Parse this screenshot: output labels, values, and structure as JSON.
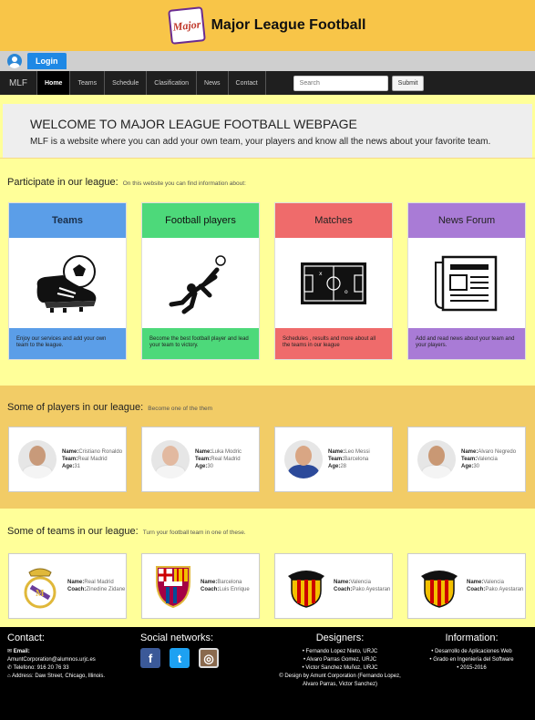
{
  "header": {
    "logo_text": "Major",
    "title": "Major League Football"
  },
  "login": {
    "label": "Login"
  },
  "nav": {
    "brand": "MLF",
    "items": [
      {
        "label": "Home"
      },
      {
        "label": "Teams"
      },
      {
        "label": "Schedule"
      },
      {
        "label": "Clasification"
      },
      {
        "label": "News"
      },
      {
        "label": "Contact"
      }
    ],
    "search_placeholder": "Search",
    "submit_label": "Submit"
  },
  "welcome": {
    "title": "WELCOME TO MAJOR LEAGUE FOOTBALL WEBPAGE",
    "text": "MLF is a website where you can add your own team, your players and know all the news about your favorite team."
  },
  "participate": {
    "title": "Participate in our league:",
    "subtitle": "On this website you can find information about:",
    "cards": [
      {
        "title": "Teams",
        "text": "Enjoy our services and add your own team to the league.",
        "color": "#5b9ee8",
        "icon": "football-boot-icon"
      },
      {
        "title": "Football players",
        "text": "Become the best football player and lead your team to victory.",
        "color": "#4dd97a",
        "icon": "bicycle-kick-icon"
      },
      {
        "title": "Matches",
        "text": "Schedules , results and more about all the teams in our league",
        "color": "#ef6b6b",
        "icon": "tactics-board-icon"
      },
      {
        "title": "News Forum",
        "text": "Add and read news about your team and your players.",
        "color": "#a97bd6",
        "icon": "newspaper-icon"
      }
    ]
  },
  "players": {
    "title": "Some of players in our league:",
    "subtitle": "Become one of the them",
    "name_label": "Name:",
    "team_label": "Team:",
    "age_label": "Age:",
    "items": [
      {
        "name": "Cristiano Ronaldo",
        "team": "Real Madrid",
        "age": "31",
        "skin": "#c89a7a",
        "shirt": "#f4f4f4"
      },
      {
        "name": "Luka Modric",
        "team": "Real Madrid",
        "age": "30",
        "skin": "#e2b9a0",
        "shirt": "#f4f4f4"
      },
      {
        "name": "Leo Messi",
        "team": "Barcelona",
        "age": "28",
        "skin": "#d9a684",
        "shirt": "#2c4a9a"
      },
      {
        "name": "Alvaro Negredo",
        "team": "Valencia",
        "age": "30",
        "skin": "#c99874",
        "shirt": "#f4f4f4"
      }
    ]
  },
  "teams": {
    "title": "Some of teams in our league:",
    "subtitle": "Turn your football team in one of these.",
    "name_label": "Name:",
    "coach_label": "Coach:",
    "items": [
      {
        "name": "Real Madrid",
        "coach": "Zinedine Zidane",
        "crest": "real-madrid-crest-icon"
      },
      {
        "name": "Barcelona",
        "coach": "Luis Enrique",
        "crest": "barcelona-crest-icon"
      },
      {
        "name": "Valencia",
        "coach": "Pako Ayestaran",
        "crest": "valencia-crest-icon"
      },
      {
        "name": "Valencia",
        "coach": "Pako Ayestaran",
        "crest": "valencia-crest-icon"
      }
    ]
  },
  "footer": {
    "contact": {
      "title": "Contact:",
      "email_label": "Email:",
      "email": "AmuntCorporation@alumnos.urjc.es",
      "phone": "Telefono: 916 20 76 33",
      "address": "Address: Daw Street, Chicago, Illinois."
    },
    "social": {
      "title": "Social networks:",
      "networks": [
        "facebook-icon",
        "twitter-icon",
        "instagram-icon"
      ]
    },
    "designers": {
      "title": "Designers:",
      "items": [
        "Fernando Lopez Nieto, URJC",
        "Alvaro Parras Gomez, URJC",
        "Victor Sanchez Muñoz, URJC"
      ],
      "credit": "© Design by Amunt Corporation (Fernando Lopez, Alvaro Parras, Victor Sanchez)"
    },
    "information": {
      "title": "Information:",
      "items": [
        "Desarrollo de Aplicaciones Web",
        "Grado en Ingeniería del Software",
        "2015-2016"
      ]
    }
  }
}
